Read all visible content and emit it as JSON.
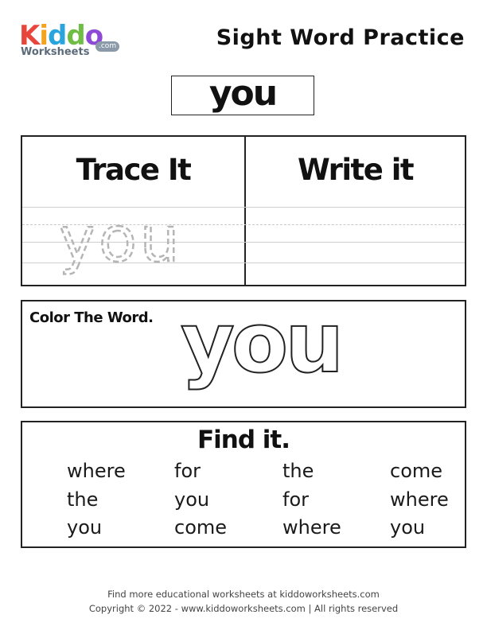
{
  "logo": {
    "letters": [
      "K",
      "i",
      "d",
      "d",
      "o"
    ],
    "letter_colors": [
      "#e8453c",
      "#f4a31f",
      "#2aa4dc",
      "#6fbd44",
      "#8e4ad6"
    ],
    "sub": "Worksheets",
    "com": ".com"
  },
  "page_title": "Sight Word Practice",
  "target_word": "you",
  "trace": {
    "heading": "Trace It",
    "trace_word": "you"
  },
  "write": {
    "heading": "Write it"
  },
  "color_section": {
    "label": "Color The Word.",
    "word": "you"
  },
  "find_section": {
    "title": "Find it.",
    "rows": [
      [
        "where",
        "for",
        "the",
        "come"
      ],
      [
        "the",
        "you",
        "for",
        "where"
      ],
      [
        "you",
        "come",
        "where",
        "you"
      ]
    ]
  },
  "footer": {
    "line1": "Find more educational worksheets at kiddoworksheets.com",
    "line2": "Copyright © 2022 - www.kiddoworksheets.com  |  All rights reserved"
  }
}
